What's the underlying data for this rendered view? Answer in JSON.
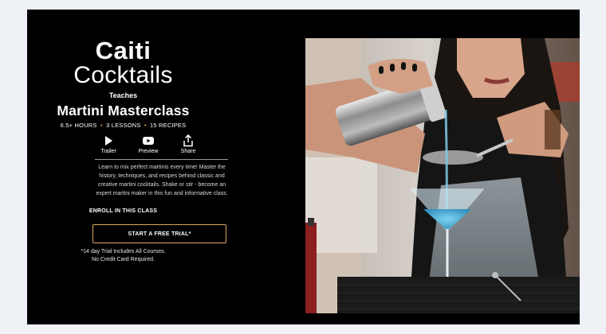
{
  "instructor": {
    "first_name": "Caiti",
    "last_name": "Cocktails"
  },
  "teaches_label": "Teaches",
  "course": {
    "title": "Martini Masterclass",
    "meta": {
      "hours": "6.5+ HOURS",
      "lessons": "3 LESSONS",
      "recipes": "15 RECIPES",
      "dot_color": "#f0a33a"
    },
    "description": "Learn to mix perfect martinis every time! Master the history, techniques, and recipes behind classic and creative martini cocktails. Shake or stir - become an expert martini maker in this fun and informative class."
  },
  "actions": [
    {
      "icon": "play-icon",
      "label": "Trailer"
    },
    {
      "icon": "video-icon",
      "label": "Preview"
    },
    {
      "icon": "share-icon",
      "label": "Share"
    }
  ],
  "enroll": {
    "label": "ENROLL IN THIS CLASS",
    "trial_button": "START A FREE TRIAL*",
    "trial_border_color": "#d9a866",
    "fine_print_line1": "*14 day Trial Includes All Courses.",
    "fine_print_line2": "No Credit Card Required."
  },
  "hero_image": {
    "icon": "bartender-pouring-martini-image"
  },
  "colors": {
    "page_bg": "#eef1f6",
    "panel_bg": "#000000",
    "text": "#ffffff"
  }
}
